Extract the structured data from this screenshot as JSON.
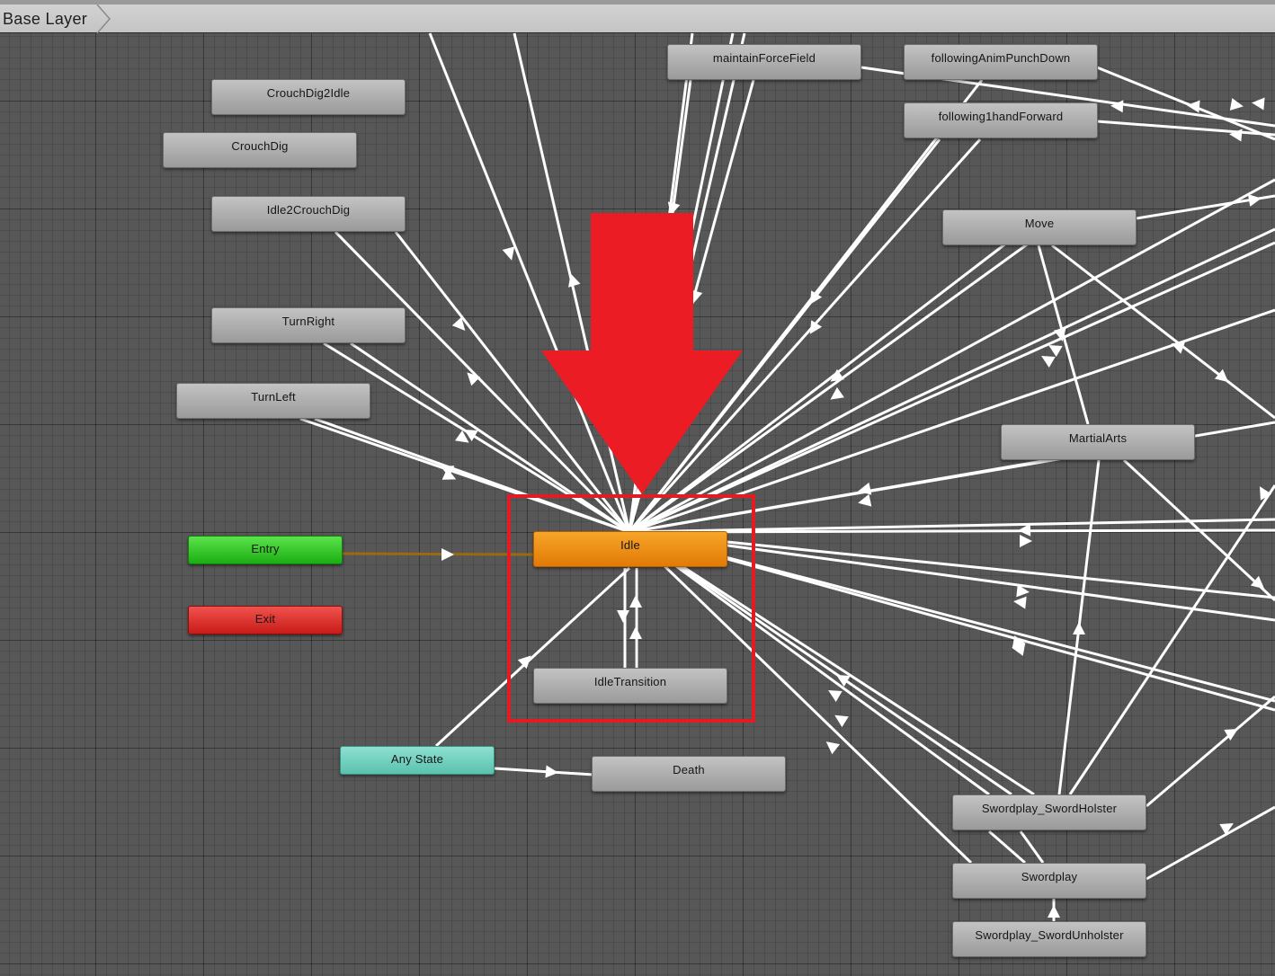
{
  "header": {
    "breadcrumb": "Base Layer"
  },
  "nodes": {
    "crouch_dig_2_idle": "CrouchDig2Idle",
    "crouch_dig": "CrouchDig",
    "idle_2_crouch_dig": "Idle2CrouchDig",
    "turn_right": "TurnRight",
    "turn_left": "TurnLeft",
    "entry": "Entry",
    "exit": "Exit",
    "any_state": "Any State",
    "idle": "Idle",
    "idle_transition": "IdleTransition",
    "death": "Death",
    "maintain_force_field": "maintainForceField",
    "following_anim_punch_down": "followingAnimPunchDown",
    "following_1hand_forward": "following1handForward",
    "move": "Move",
    "martial_arts": "MartialArts",
    "swordplay_sword_holster": "Swordplay_SwordHolster",
    "swordplay": "Swordplay",
    "swordplay_sword_unholster": "Swordplay_SwordUnholster"
  },
  "colors": {
    "canvas_background": "#575757",
    "default_state": "#b0b0b0",
    "default_state_highlighted": "#f39a17",
    "entry_state": "#2cc420",
    "exit_state": "#dd2b27",
    "any_state": "#6fd1bf",
    "transition_line": "#ffffff",
    "entry_transition_line": "#9a6a10",
    "annotation_red": "#e31b23"
  },
  "annotations": {
    "highlight_box": "red-rectangle",
    "pointer": "red-down-arrow"
  }
}
